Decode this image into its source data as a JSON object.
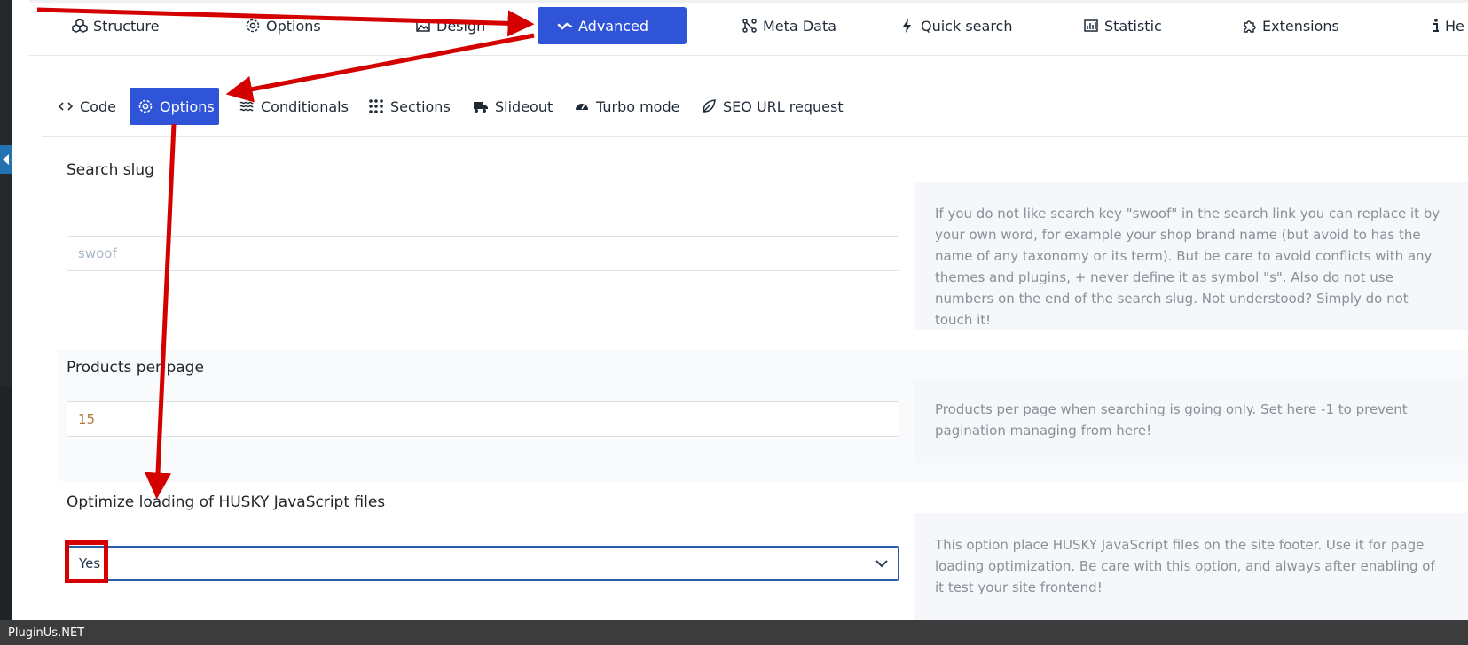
{
  "top_tabs": [
    {
      "label": "Structure",
      "icon": "cubes-icon",
      "active": false
    },
    {
      "label": "Options",
      "icon": "gear-icon",
      "active": false
    },
    {
      "label": "Design",
      "icon": "image-icon",
      "active": false
    },
    {
      "label": "Advanced",
      "icon": "wave-icon",
      "active": true
    },
    {
      "label": "Meta Data",
      "icon": "nodes-icon",
      "active": false
    },
    {
      "label": "Quick search",
      "icon": "bolt-icon",
      "active": false
    },
    {
      "label": "Statistic",
      "icon": "bar-chart-icon",
      "active": false
    },
    {
      "label": "Extensions",
      "icon": "puzzle-icon",
      "active": false
    },
    {
      "label": "He",
      "icon": "info-icon",
      "active": false
    }
  ],
  "sub_tabs": [
    {
      "label": "Code",
      "icon": "code-icon",
      "active": false
    },
    {
      "label": "Options",
      "icon": "gear-icon",
      "active": true
    },
    {
      "label": "Conditionals",
      "icon": "waves-icon",
      "active": false
    },
    {
      "label": "Sections",
      "icon": "grid-icon",
      "active": false
    },
    {
      "label": "Slideout",
      "icon": "truck-icon",
      "active": false
    },
    {
      "label": "Turbo mode",
      "icon": "speedometer-icon",
      "active": false
    },
    {
      "label": "SEO URL request",
      "icon": "leaf-icon",
      "active": false
    }
  ],
  "search_slug": {
    "label": "Search slug",
    "placeholder": "swoof",
    "help": "If you do not like search key \"swoof\" in the search link you can replace it by your own word, for example your shop brand name (but avoid to has the name of any taxonomy or its term). But be care to avoid conflicts with any themes and plugins, + never define it as symbol \"s\". Also do not use numbers on the end of the search slug. Not understood? Simply do not touch it!"
  },
  "products_per_page": {
    "label": "Products per page",
    "value": "15",
    "help": "Products per page when searching is going only. Set here -1 to prevent pagination managing from here!"
  },
  "optimize_loading": {
    "label": "Optimize loading of HUSKY JavaScript files",
    "selected": "Yes",
    "help": "This option place HUSKY JavaScript files on the site footer. Use it for page loading optimization. Be care with this option, and always after enabling of it test your site frontend!"
  },
  "status_bar": {
    "text": "PluginUs.NET"
  },
  "colors": {
    "accent": "#2f54d8",
    "annotation": "#d40000"
  }
}
